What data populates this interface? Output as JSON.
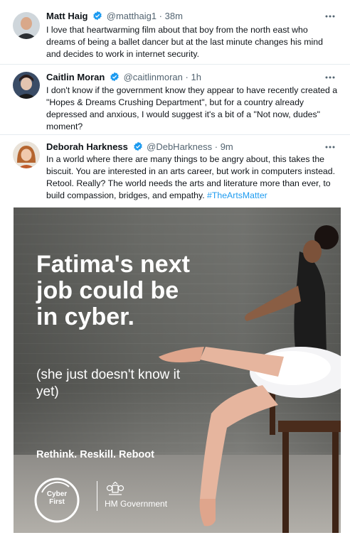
{
  "tweets": [
    {
      "name": "Matt Haig",
      "handle": "@matthaig1",
      "separator": "·",
      "time": "38m",
      "text": "I love that heartwarming film about that boy from the north east who dreams of being a ballet dancer but at the last minute changes his mind and decides to work in internet security."
    },
    {
      "name": "Caitlin Moran",
      "handle": "@caitlinmoran",
      "separator": "·",
      "time": "1h",
      "text": "I don't know if the government know they appear to have recently created a \"Hopes & Dreams Crushing Department\", but for a country already depressed and anxious, I would suggest it's a bit of a \"Not now, dudes\" moment?"
    },
    {
      "name": "Deborah Harkness",
      "handle": "@DebHarkness",
      "separator": "·",
      "time": "9m",
      "text": "In a world where there are many things to be angry about, this takes the biscuit. You are interested in an arts career, but work in computers instead. Retool. Really? The world needs the arts and literature more than ever, to build compassion, bridges, and empathy. ",
      "hashtag": "#TheArtsMatter"
    }
  ],
  "media": {
    "headline": "Fatima's next job could be in cyber.",
    "subline": "(she just doesn't know it yet)",
    "tagline": "Rethink. Reskill. Reboot",
    "logo_line1": "Cyber",
    "logo_line2": "First",
    "government": "HM Government"
  },
  "colors": {
    "verified": "#1d9bf0",
    "hashtag": "#1d9bf0",
    "muted": "#536471"
  },
  "icons": [
    "verified-badge-icon",
    "more-options-icon",
    "cyberfirst-logo-icon",
    "royal-crest-icon"
  ]
}
